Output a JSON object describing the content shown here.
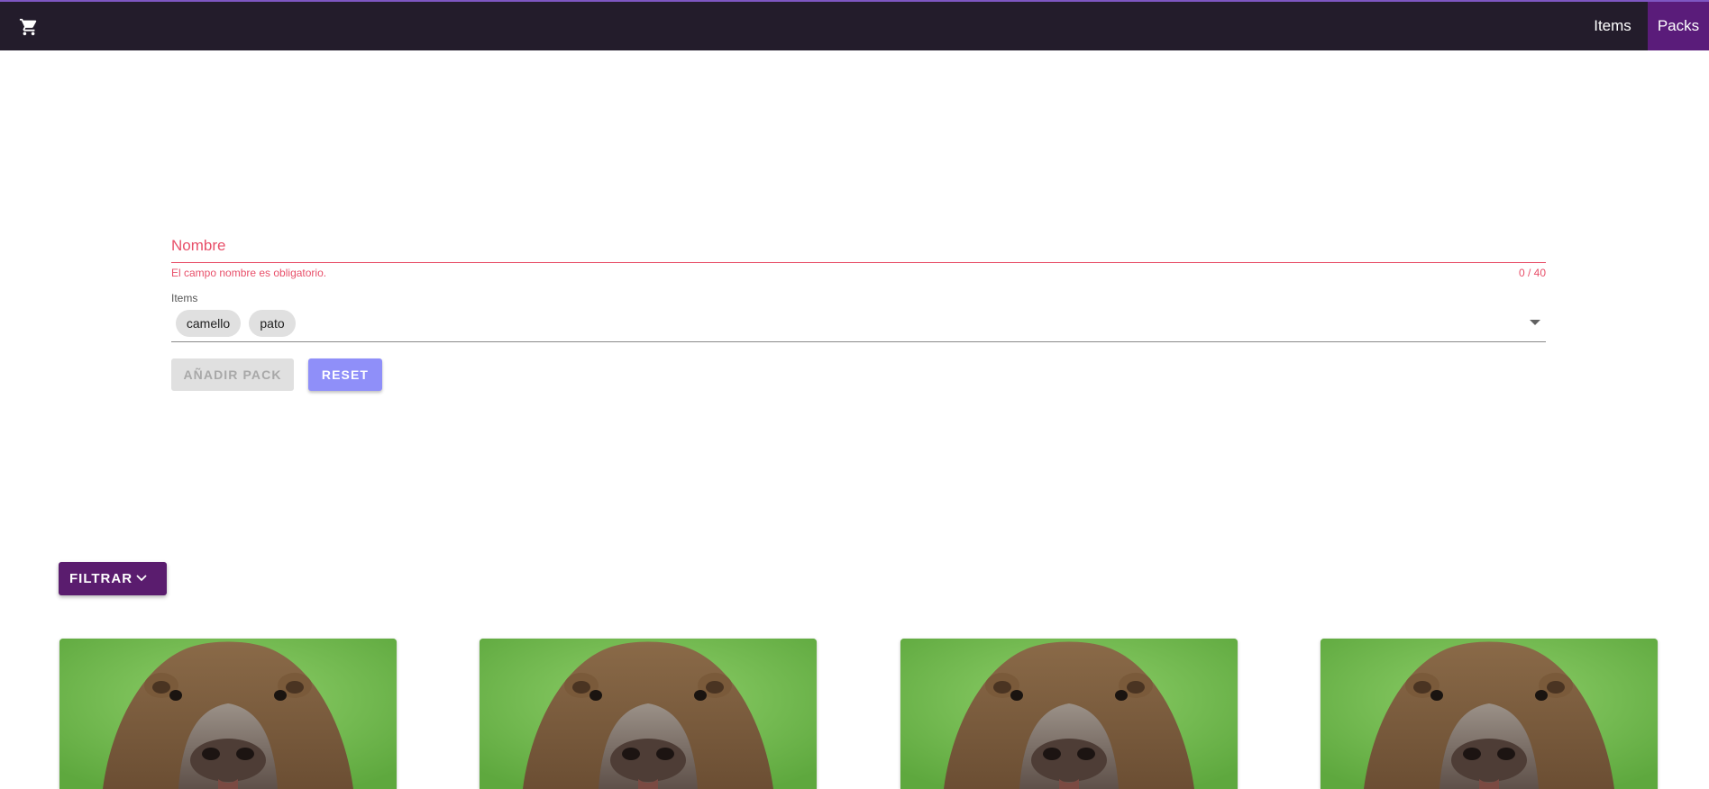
{
  "navbar": {
    "icon": "shopping-cart-icon",
    "links": [
      "Items",
      "Packs"
    ],
    "active": "Packs",
    "colors": {
      "bar": "#231c2b",
      "active": "#5a1c7a",
      "accent": "#7e57c2"
    }
  },
  "form": {
    "name_label": "Nombre",
    "name_value": "",
    "name_error": "El campo nombre es obligatorio.",
    "name_counter": "0 / 40",
    "items_label": "Items",
    "selected_items": [
      "camello",
      "pato"
    ],
    "add_button": "AÑADIR PACK",
    "reset_button": "RESET",
    "colors": {
      "error": "#e8506a",
      "reset": "#8f8ff9"
    }
  },
  "filter": {
    "button_label": "FILTRAR",
    "icon": "chevron-down-icon",
    "color": "#5a1c6e"
  },
  "cards": [
    {
      "image": "capybara-photo"
    },
    {
      "image": "capybara-photo"
    },
    {
      "image": "capybara-photo"
    },
    {
      "image": "capybara-photo"
    }
  ]
}
